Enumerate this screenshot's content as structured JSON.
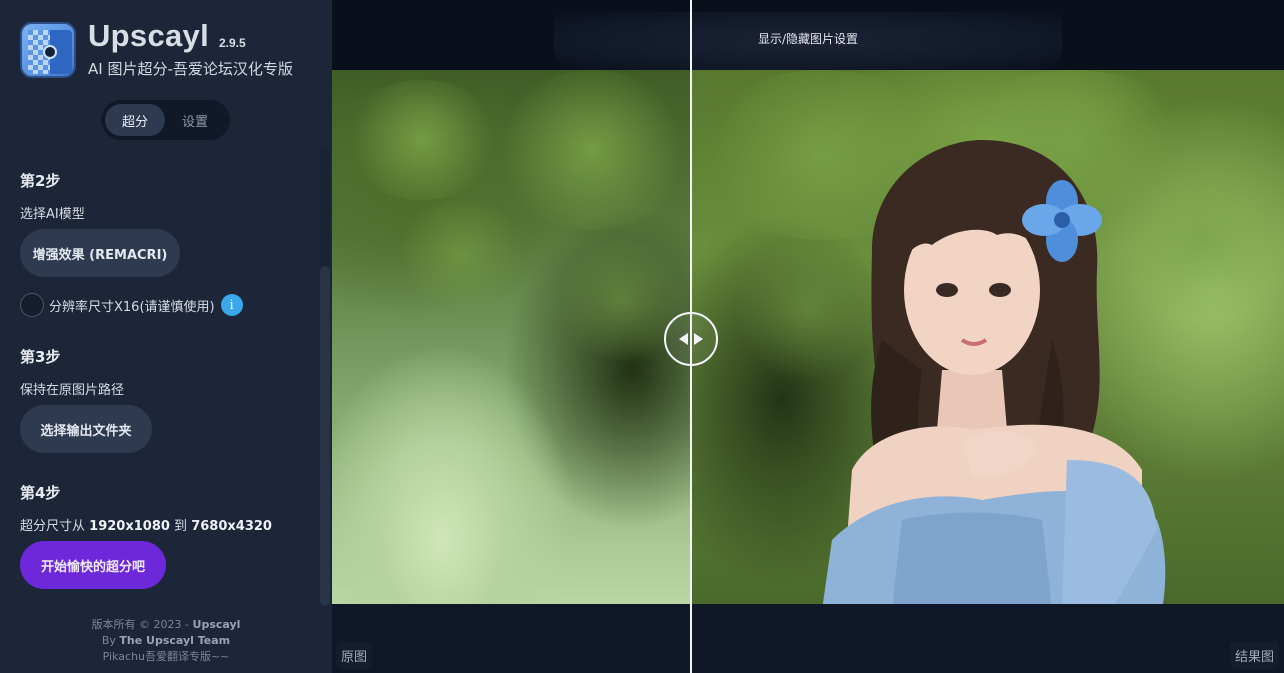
{
  "app": {
    "name": "Upscayl",
    "version": "2.9.5",
    "subtitle": "AI 图片超分-吾爱论坛汉化专版"
  },
  "tabs": [
    {
      "label": "超分",
      "active": true
    },
    {
      "label": "设置",
      "active": false
    }
  ],
  "steps": {
    "step2": {
      "title": "第2步",
      "model_label": "选择AI模型",
      "model_button": "增强效果 (REMACRI)",
      "checkbox_label": "分辨率尺寸X16(请谨慎使用)",
      "checkbox_checked": false,
      "info_glyph": "i"
    },
    "step3": {
      "title": "第3步",
      "path_label": "保持在原图片路径",
      "output_button": "选择输出文件夹"
    },
    "step4": {
      "title": "第4步",
      "size_prefix": "超分尺寸从",
      "size_from": "1920x1080",
      "size_mid": "到",
      "size_to": "7680x4320",
      "start_button": "开始愉快的超分吧"
    }
  },
  "footer": {
    "line1_prefix": "版本所有 © 2023 - ",
    "line1_brand": "Upscayl",
    "line2_prefix": "By ",
    "line2_team": "The Upscayl Team",
    "line3": "Pikachu吾爱翻译专版~~"
  },
  "viewer": {
    "settings_toggle": "显示/隐藏图片设置",
    "original_label": "原图",
    "result_label": "结果图",
    "slider_position_pct": 37.8
  },
  "colors": {
    "sidebar_bg": "#1d2638",
    "main_bg": "#101726",
    "accent_purple": "#6d28d9",
    "info_blue": "#39a7ec",
    "pill_bg": "#2e3a50"
  },
  "icons": {
    "logo": "upscayl-logo-icon",
    "info": "info-icon",
    "slider": "left-right-arrows-icon"
  }
}
